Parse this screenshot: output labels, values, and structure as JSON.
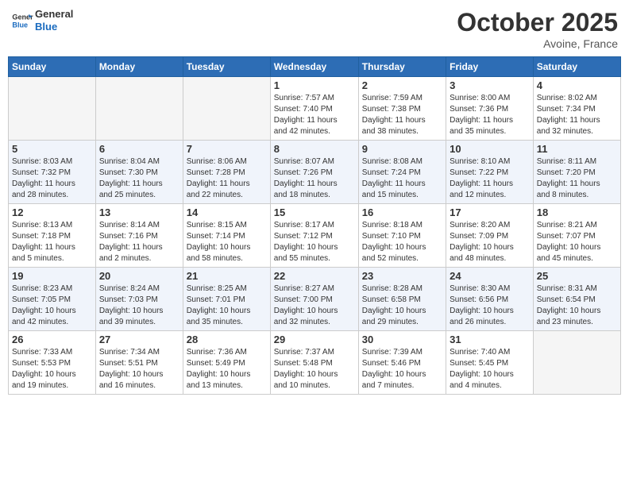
{
  "header": {
    "logo_general": "General",
    "logo_blue": "Blue",
    "month": "October 2025",
    "location": "Avoine, France"
  },
  "weekdays": [
    "Sunday",
    "Monday",
    "Tuesday",
    "Wednesday",
    "Thursday",
    "Friday",
    "Saturday"
  ],
  "weeks": [
    [
      {
        "day": "",
        "info": ""
      },
      {
        "day": "",
        "info": ""
      },
      {
        "day": "",
        "info": ""
      },
      {
        "day": "1",
        "info": "Sunrise: 7:57 AM\nSunset: 7:40 PM\nDaylight: 11 hours\nand 42 minutes."
      },
      {
        "day": "2",
        "info": "Sunrise: 7:59 AM\nSunset: 7:38 PM\nDaylight: 11 hours\nand 38 minutes."
      },
      {
        "day": "3",
        "info": "Sunrise: 8:00 AM\nSunset: 7:36 PM\nDaylight: 11 hours\nand 35 minutes."
      },
      {
        "day": "4",
        "info": "Sunrise: 8:02 AM\nSunset: 7:34 PM\nDaylight: 11 hours\nand 32 minutes."
      }
    ],
    [
      {
        "day": "5",
        "info": "Sunrise: 8:03 AM\nSunset: 7:32 PM\nDaylight: 11 hours\nand 28 minutes."
      },
      {
        "day": "6",
        "info": "Sunrise: 8:04 AM\nSunset: 7:30 PM\nDaylight: 11 hours\nand 25 minutes."
      },
      {
        "day": "7",
        "info": "Sunrise: 8:06 AM\nSunset: 7:28 PM\nDaylight: 11 hours\nand 22 minutes."
      },
      {
        "day": "8",
        "info": "Sunrise: 8:07 AM\nSunset: 7:26 PM\nDaylight: 11 hours\nand 18 minutes."
      },
      {
        "day": "9",
        "info": "Sunrise: 8:08 AM\nSunset: 7:24 PM\nDaylight: 11 hours\nand 15 minutes."
      },
      {
        "day": "10",
        "info": "Sunrise: 8:10 AM\nSunset: 7:22 PM\nDaylight: 11 hours\nand 12 minutes."
      },
      {
        "day": "11",
        "info": "Sunrise: 8:11 AM\nSunset: 7:20 PM\nDaylight: 11 hours\nand 8 minutes."
      }
    ],
    [
      {
        "day": "12",
        "info": "Sunrise: 8:13 AM\nSunset: 7:18 PM\nDaylight: 11 hours\nand 5 minutes."
      },
      {
        "day": "13",
        "info": "Sunrise: 8:14 AM\nSunset: 7:16 PM\nDaylight: 11 hours\nand 2 minutes."
      },
      {
        "day": "14",
        "info": "Sunrise: 8:15 AM\nSunset: 7:14 PM\nDaylight: 10 hours\nand 58 minutes."
      },
      {
        "day": "15",
        "info": "Sunrise: 8:17 AM\nSunset: 7:12 PM\nDaylight: 10 hours\nand 55 minutes."
      },
      {
        "day": "16",
        "info": "Sunrise: 8:18 AM\nSunset: 7:10 PM\nDaylight: 10 hours\nand 52 minutes."
      },
      {
        "day": "17",
        "info": "Sunrise: 8:20 AM\nSunset: 7:09 PM\nDaylight: 10 hours\nand 48 minutes."
      },
      {
        "day": "18",
        "info": "Sunrise: 8:21 AM\nSunset: 7:07 PM\nDaylight: 10 hours\nand 45 minutes."
      }
    ],
    [
      {
        "day": "19",
        "info": "Sunrise: 8:23 AM\nSunset: 7:05 PM\nDaylight: 10 hours\nand 42 minutes."
      },
      {
        "day": "20",
        "info": "Sunrise: 8:24 AM\nSunset: 7:03 PM\nDaylight: 10 hours\nand 39 minutes."
      },
      {
        "day": "21",
        "info": "Sunrise: 8:25 AM\nSunset: 7:01 PM\nDaylight: 10 hours\nand 35 minutes."
      },
      {
        "day": "22",
        "info": "Sunrise: 8:27 AM\nSunset: 7:00 PM\nDaylight: 10 hours\nand 32 minutes."
      },
      {
        "day": "23",
        "info": "Sunrise: 8:28 AM\nSunset: 6:58 PM\nDaylight: 10 hours\nand 29 minutes."
      },
      {
        "day": "24",
        "info": "Sunrise: 8:30 AM\nSunset: 6:56 PM\nDaylight: 10 hours\nand 26 minutes."
      },
      {
        "day": "25",
        "info": "Sunrise: 8:31 AM\nSunset: 6:54 PM\nDaylight: 10 hours\nand 23 minutes."
      }
    ],
    [
      {
        "day": "26",
        "info": "Sunrise: 7:33 AM\nSunset: 5:53 PM\nDaylight: 10 hours\nand 19 minutes."
      },
      {
        "day": "27",
        "info": "Sunrise: 7:34 AM\nSunset: 5:51 PM\nDaylight: 10 hours\nand 16 minutes."
      },
      {
        "day": "28",
        "info": "Sunrise: 7:36 AM\nSunset: 5:49 PM\nDaylight: 10 hours\nand 13 minutes."
      },
      {
        "day": "29",
        "info": "Sunrise: 7:37 AM\nSunset: 5:48 PM\nDaylight: 10 hours\nand 10 minutes."
      },
      {
        "day": "30",
        "info": "Sunrise: 7:39 AM\nSunset: 5:46 PM\nDaylight: 10 hours\nand 7 minutes."
      },
      {
        "day": "31",
        "info": "Sunrise: 7:40 AM\nSunset: 5:45 PM\nDaylight: 10 hours\nand 4 minutes."
      },
      {
        "day": "",
        "info": ""
      }
    ]
  ]
}
